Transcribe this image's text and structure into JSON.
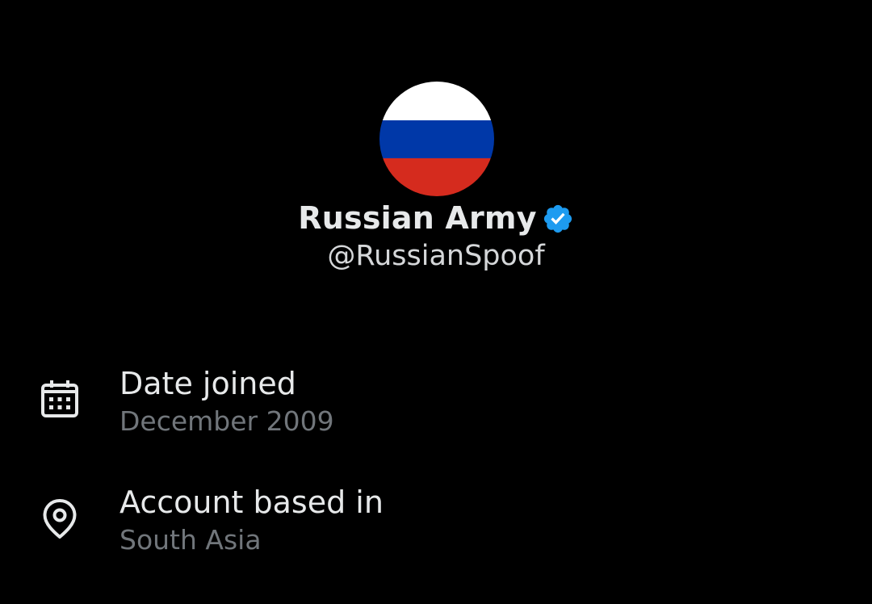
{
  "profile": {
    "display_name": "Russian Army",
    "handle": "@RussianSpoof",
    "verified": true,
    "avatar": {
      "icon": "russian-flag",
      "colors": [
        "#ffffff",
        "#0038a8",
        "#d52b1e"
      ]
    },
    "badge_color": "#1d9bf0"
  },
  "about": {
    "date_joined": {
      "icon": "calendar-icon",
      "title": "Date joined",
      "value": "December 2009"
    },
    "account_based_in": {
      "icon": "location-pin-icon",
      "title": "Account based in",
      "value": "South Asia"
    }
  },
  "theme": {
    "background": "#000000",
    "primary_text": "#e7e9ea",
    "secondary_text": "#71767b"
  }
}
